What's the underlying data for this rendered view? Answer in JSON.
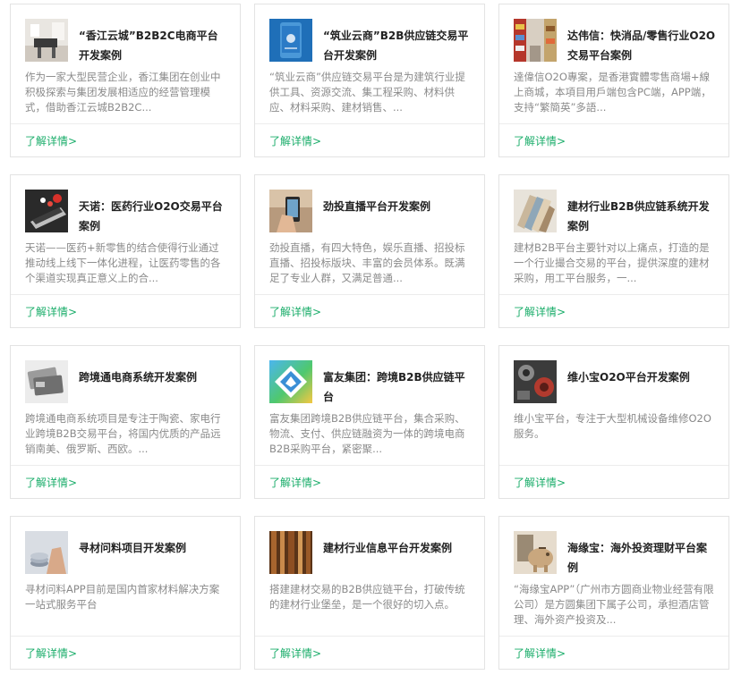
{
  "cases": [
    {
      "icon": "office-photo-icon",
      "title": "“香江云城”B2B2C电商平台开发案例",
      "desc": "作为一家大型民营企业，香江集团在创业中积极探索与集团发展相适应的经营管理模式，借助香江云城B2B2C...",
      "more": "了解详情>"
    },
    {
      "icon": "phone-app-icon",
      "title": "“筑业云商”B2B供应链交易平台开发案例",
      "desc": "“筑业云商”供应链交易平台是为建筑行业提供工具、资源交流、集工程采购、材料供应、材料采购、建材销售、...",
      "more": "了解详情>"
    },
    {
      "icon": "supermarket-shelf-icon",
      "title": "达伟信：快消品/零售行业O2O交易平台案例",
      "desc": "達偉信O2O專案，是香港實體零售商場+線上商城，本項目用戶端包含PC端，APP端，支持“繁簡英”多語...",
      "more": "了解详情>"
    },
    {
      "icon": "medicine-laptop-icon",
      "title": "天诺：医药行业O2O交易平台案例",
      "desc": "天诺——医药+新零售的结合使得行业通过推动线上线下一体化进程，让医药零售的各个渠道实现真正意义上的合...",
      "more": "了解详情>"
    },
    {
      "icon": "hand-phone-icon",
      "title": "劲投直播平台开发案例",
      "desc": "劲投直播，有四大特色，娱乐直播、招投标直播、招投标版块、丰富的会员体系。既满足了专业人群，又满足普通...",
      "more": "了解详情>"
    },
    {
      "icon": "color-swatches-icon",
      "title": "建材行业B2B供应链系统开发案例",
      "desc": "建材B2B平台主要针对以上痛点，打造的是一个行业撮合交易的平台，提供深度的建材采购，用工平台服务，一...",
      "more": "了解详情>"
    },
    {
      "icon": "bank-cards-icon",
      "title": "跨境通电商系统开发案例",
      "desc": "跨境通电商系统项目是专注于陶瓷、家电行业跨境B2B交易平台，将国内优质的产品远销南美、俄罗斯、西欧。...",
      "more": "了解详情>"
    },
    {
      "icon": "fuyou-logo-icon",
      "title": "富友集团：跨境B2B供应链平台",
      "desc": "富友集团跨境B2B供应链平台，集合采购、物流、支付、供应链融资为一体的跨境电商B2B采购平台，紧密聚...",
      "more": "了解详情>"
    },
    {
      "icon": "machinery-parts-icon",
      "title": "维小宝O2O平台开发案例",
      "desc": "维小宝平台，专注于大型机械设备维修O2O服务。",
      "more": "了解详情>"
    },
    {
      "icon": "coins-hand-icon",
      "title": "寻材问料项目开发案例",
      "desc": "寻材问料APP目前是国内首家材料解决方案一站式服务平台",
      "more": "了解详情>"
    },
    {
      "icon": "wood-texture-icon",
      "title": "建材行业信息平台开发案例",
      "desc": "搭建建材交易的B2B供应链平台，打破传统的建材行业堡垒，是一个很好的切入点。",
      "more": "了解详情>"
    },
    {
      "icon": "piggy-bank-icon",
      "title": "海缘宝：海外投资理财平台案例",
      "desc": "“海缘宝APP”（广州市方圆商业物业经营有限公司）是方圆集团下属子公司，承担酒店管理、海外资产投资及...",
      "more": "了解详情>"
    }
  ]
}
